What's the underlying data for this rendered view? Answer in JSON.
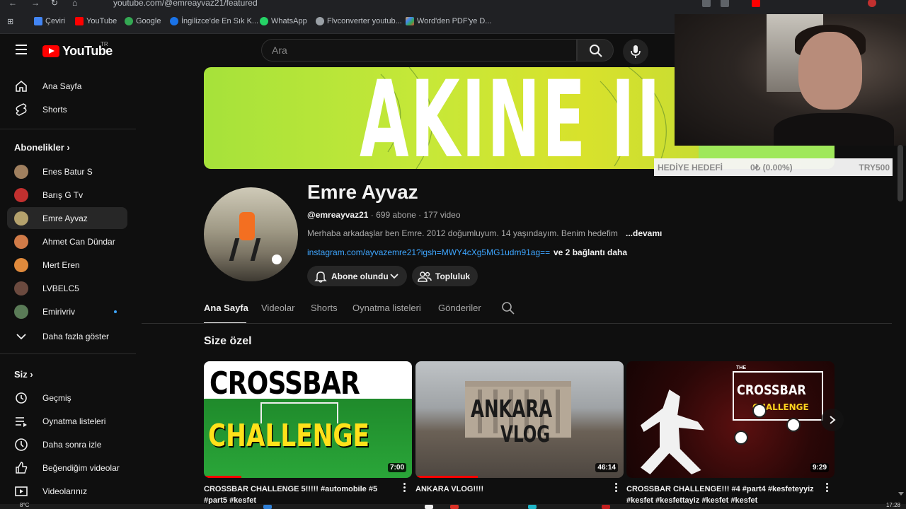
{
  "browser": {
    "url": "youtube.com/@emreayvaz21/featured",
    "bookmarks": [
      {
        "label": "Çeviri",
        "color": "#4285f4"
      },
      {
        "label": "YouTube",
        "color": "#ff0000"
      },
      {
        "label": "Google",
        "color": "#34a853"
      },
      {
        "label": "İngilizce'de En Sık K...",
        "color": "#1a73e8"
      },
      {
        "label": "WhatsApp",
        "color": "#25d366"
      },
      {
        "label": "Flvconverter youtub...",
        "color": "#9aa0a6"
      },
      {
        "label": "Word'den PDF'ye D...",
        "color": "#e8a33d"
      }
    ]
  },
  "header": {
    "logo_text": "YouTube",
    "region": "TR",
    "search_placeholder": "Ara"
  },
  "sidebar": {
    "main": [
      {
        "label": "Ana Sayfa",
        "icon": "home-icon"
      },
      {
        "label": "Shorts",
        "icon": "shorts-icon"
      }
    ],
    "subscriptions_heading": "Abonelikler",
    "subscriptions": [
      {
        "label": "Enes Batur S",
        "color": "#a0805f"
      },
      {
        "label": "Barış G Tv",
        "color": "#c2302f"
      },
      {
        "label": "Emre Ayvaz",
        "color": "#b5a26d"
      },
      {
        "label": "Ahmet Can Dündar",
        "color": "#d17b48"
      },
      {
        "label": "Mert Eren",
        "color": "#e08a3c"
      },
      {
        "label": "LVBELC5",
        "color": "#6b4a3f"
      },
      {
        "label": "Emirivriv",
        "color": "#5a7b57"
      }
    ],
    "show_more": "Daha fazla göster",
    "you_heading": "Siz",
    "you_items": [
      {
        "label": "Geçmiş",
        "icon": "history-icon"
      },
      {
        "label": "Oynatma listeleri",
        "icon": "playlists-icon"
      },
      {
        "label": "Daha sonra izle",
        "icon": "watch-later-icon"
      },
      {
        "label": "Beğendiğim videolar",
        "icon": "like-icon"
      },
      {
        "label": "Videolarınız",
        "icon": "your-videos-icon"
      }
    ]
  },
  "overlay": {
    "gift_label": "HEDİYE HEDEFİ",
    "gift_progress": "0₺ (0.00%)",
    "gift_goal": "TRY500"
  },
  "channel": {
    "banner_text": "AKINE II",
    "name": "Emre Ayvaz",
    "handle": "@emreayvaz21",
    "meta": " · 699 abone · 177 video",
    "description": "Merhaba arkadaşlar ben Emre. 2012 doğumluyum. 14 yaşındayım. Benim hedefim",
    "more": "...devamı",
    "link": "instagram.com/ayvazemre21?igsh=MWY4cXg5MG1udm91ag==",
    "link_more": "ve 2 bağlantı daha",
    "subscribe_label": "Abone olundu",
    "community_label": "Topluluk"
  },
  "tabs": [
    "Ana Sayfa",
    "Videolar",
    "Shorts",
    "Oynatma listeleri",
    "Gönderiler"
  ],
  "section_title": "Size özel",
  "videos": [
    {
      "title": "CROSSBAR CHALLENGE 5!!!!! #automobile #5 #part5 #kesfet",
      "duration": "7:00",
      "thumb_line1": "CROSSBAR",
      "thumb_line2": "CHALLENGE",
      "watched_percent": 18
    },
    {
      "title": "ANKARA VLOG!!!!",
      "duration": "46:14",
      "thumb_line1": "ANKARA",
      "thumb_line2": "VLOG",
      "watched_percent": 30
    },
    {
      "title": "CROSSBAR CHALLENGE!!! #4 #part4 #kesfeteyyiz #kesfet #kesfettayiz #kesfet #kesfet",
      "duration": "9:29",
      "thumb_line0": "THE",
      "thumb_line1": "CROSSBAR",
      "thumb_line2": "CHALLENGE",
      "watched_percent": 0
    }
  ],
  "taskbar": {
    "temp": "8°C",
    "time": "17:28"
  }
}
